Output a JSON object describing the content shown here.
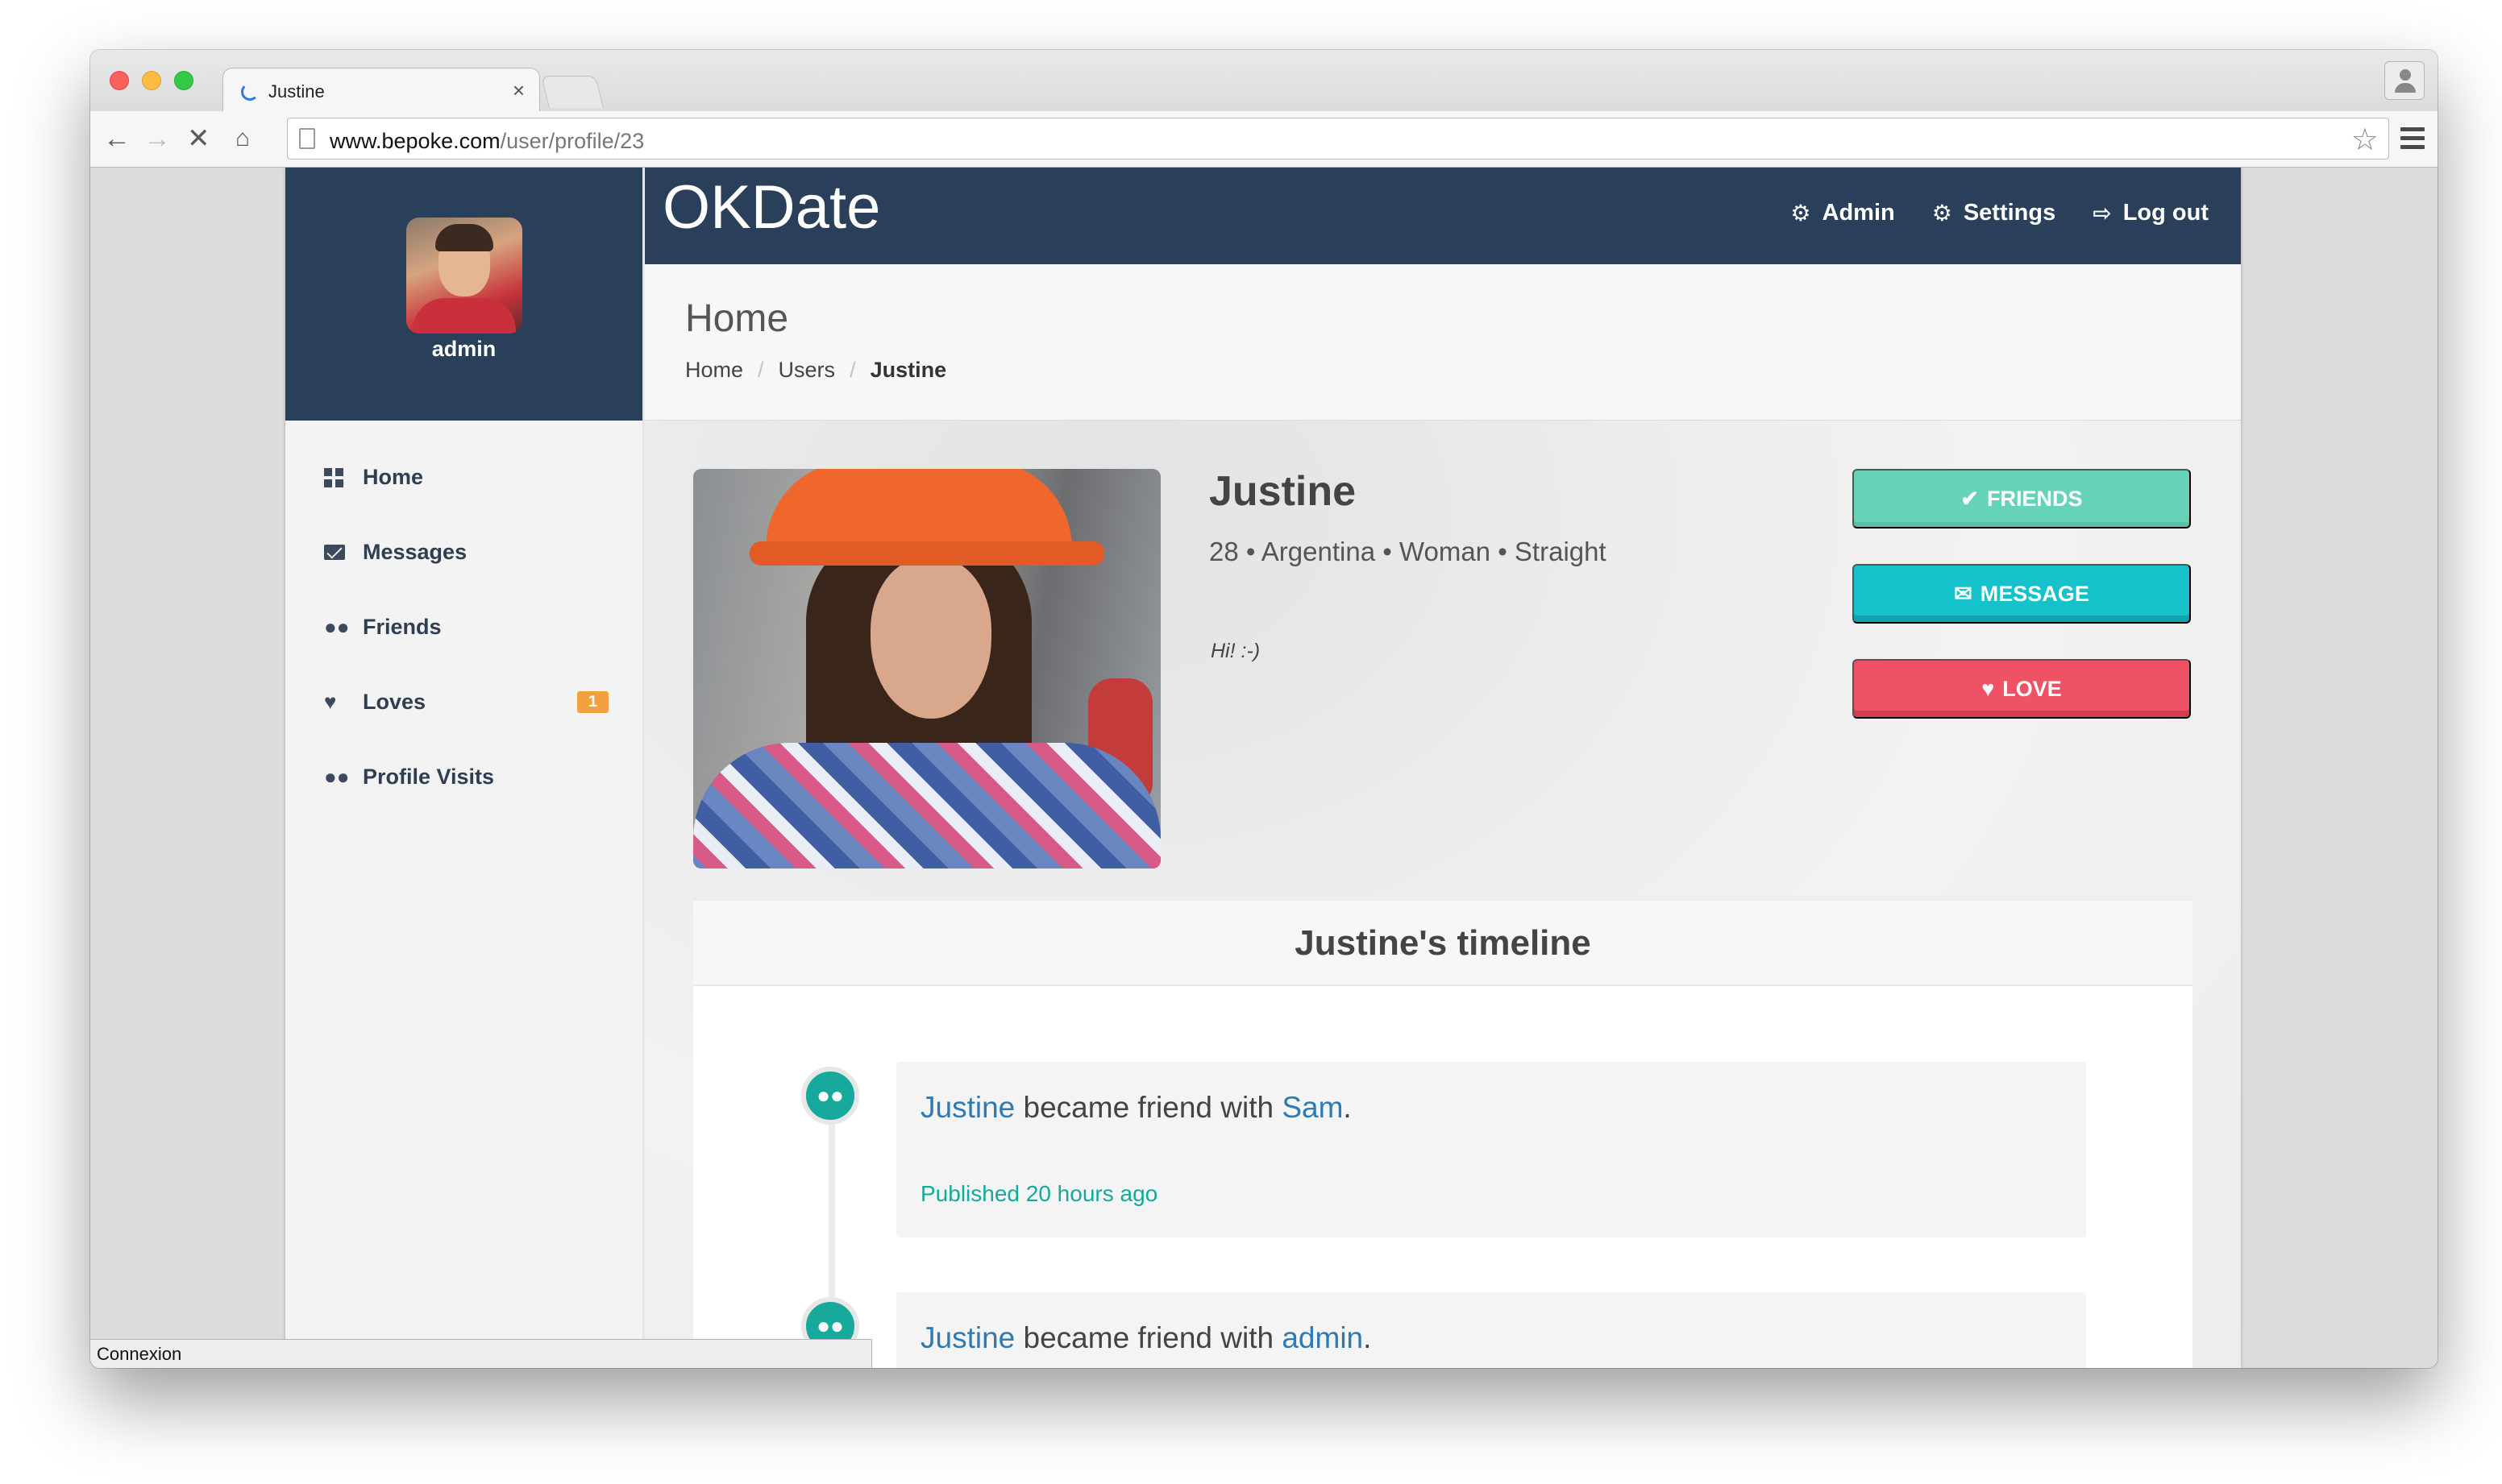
{
  "browser": {
    "tab_title": "Justine",
    "tab_close": "×",
    "url_host": "www.bepoke.com",
    "url_path": "/user/profile/23",
    "status_text": "Connexion"
  },
  "app": {
    "brand": "OKDate",
    "top_links": [
      {
        "label": "Admin",
        "icon": "admin-cogs-icon"
      },
      {
        "label": "Settings",
        "icon": "gear-icon"
      },
      {
        "label": "Log out",
        "icon": "logout-icon"
      }
    ],
    "sidebar": {
      "username": "admin",
      "items": [
        {
          "label": "Home",
          "icon": "dashboard-icon"
        },
        {
          "label": "Messages",
          "icon": "envelope-icon"
        },
        {
          "label": "Friends",
          "icon": "users-icon"
        },
        {
          "label": "Loves",
          "icon": "heart-icon",
          "badge": "1"
        },
        {
          "label": "Profile Visits",
          "icon": "users-icon"
        }
      ]
    },
    "page_header": {
      "title": "Home",
      "breadcrumb": [
        "Home",
        "Users",
        "Justine"
      ],
      "separator": "/"
    },
    "profile": {
      "name": "Justine",
      "meta": "28 • Argentina • Woman • Straight",
      "bio": "Hi! :-)",
      "buttons": {
        "friends": "FRIENDS",
        "message": "MESSAGE",
        "love": "LOVE"
      }
    },
    "timeline": {
      "title": "Justine's timeline",
      "entries": [
        {
          "actor": "Justine",
          "action": " became friend with ",
          "target": "Sam",
          "suffix": ".",
          "time": "Published 20 hours ago"
        },
        {
          "actor": "Justine",
          "action": " became friend with ",
          "target": "admin",
          "suffix": ".",
          "time": ""
        }
      ]
    }
  },
  "colors": {
    "navy": "#2a3f59",
    "teal": "#16a99c",
    "friends_green": "#66d3b9",
    "message_cyan": "#15c2cc",
    "love_red": "#ef5165",
    "badge_orange": "#f1a13d",
    "link_blue": "#2e7ab5"
  }
}
